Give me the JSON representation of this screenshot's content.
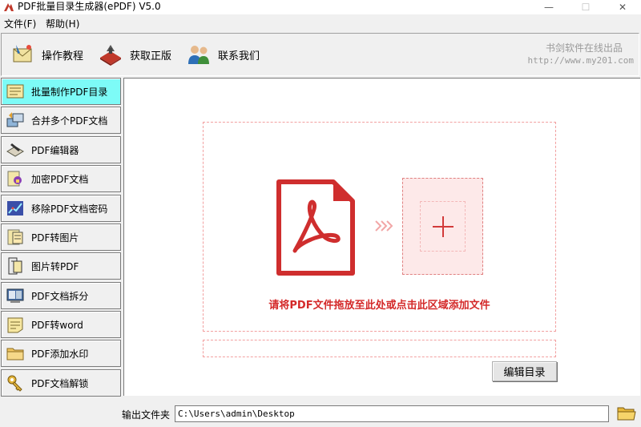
{
  "window": {
    "title": "PDF批量目录生成器(ePDF) V5.0",
    "min_glyph": "—",
    "max_glyph": "☐",
    "close_glyph": "✕"
  },
  "menu": [
    {
      "label": "文件(F)"
    },
    {
      "label": "帮助(H)"
    }
  ],
  "toolbar": {
    "buttons": [
      {
        "label": "操作教程",
        "icon": "tutorial-icon"
      },
      {
        "label": "获取正版",
        "icon": "purchase-icon"
      },
      {
        "label": "联系我们",
        "icon": "contact-icon"
      }
    ],
    "watermark_line1": "书剑软件在线出品",
    "watermark_line2": "http://www.my201.com"
  },
  "sidebar": {
    "items": [
      {
        "label": "批量制作PDF目录",
        "icon": "toc-list-icon",
        "active": true
      },
      {
        "label": "合并多个PDF文档",
        "icon": "merge-icon",
        "active": false
      },
      {
        "label": "PDF编辑器",
        "icon": "editor-icon",
        "active": false
      },
      {
        "label": "加密PDF文档",
        "icon": "encrypt-icon",
        "active": false
      },
      {
        "label": "移除PDF文档密码",
        "icon": "remove-password-icon",
        "active": false
      },
      {
        "label": "PDF转图片",
        "icon": "pdf-to-image-icon",
        "active": false
      },
      {
        "label": "图片转PDF",
        "icon": "image-to-pdf-icon",
        "active": false
      },
      {
        "label": "PDF文档拆分",
        "icon": "split-icon",
        "active": false
      },
      {
        "label": "PDF转word",
        "icon": "pdf-to-word-icon",
        "active": false
      },
      {
        "label": "PDF添加水印",
        "icon": "watermark-icon",
        "active": false
      },
      {
        "label": "PDF文档解锁",
        "icon": "unlock-icon",
        "active": false
      }
    ],
    "active_color": "#7dfbf7"
  },
  "main": {
    "drop_text": "请将PDF文件拖放至此处或点击此区域添加文件",
    "edit_button": "编辑目录",
    "accent_color": "#d42a2a"
  },
  "output": {
    "label": "输出文件夹",
    "path": "C:\\Users\\admin\\Desktop"
  }
}
